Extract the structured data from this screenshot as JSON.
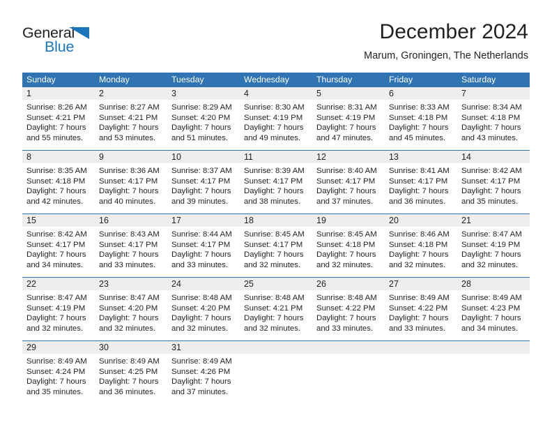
{
  "brand": {
    "name_top": "General",
    "name_bottom": "Blue",
    "accent_color": "#1b75bb",
    "triangle_icon": "triangle-icon"
  },
  "header": {
    "title": "December 2024",
    "location": "Marum, Groningen, The Netherlands",
    "header_bg_color": "#3174b4",
    "daynum_bg_color": "#eeeeee"
  },
  "weekdays": [
    "Sunday",
    "Monday",
    "Tuesday",
    "Wednesday",
    "Thursday",
    "Friday",
    "Saturday"
  ],
  "weeks": [
    {
      "days": [
        {
          "num": "1",
          "sunrise": "Sunrise: 8:26 AM",
          "sunset": "Sunset: 4:21 PM",
          "daylight1": "Daylight: 7 hours",
          "daylight2": "and 55 minutes."
        },
        {
          "num": "2",
          "sunrise": "Sunrise: 8:27 AM",
          "sunset": "Sunset: 4:21 PM",
          "daylight1": "Daylight: 7 hours",
          "daylight2": "and 53 minutes."
        },
        {
          "num": "3",
          "sunrise": "Sunrise: 8:29 AM",
          "sunset": "Sunset: 4:20 PM",
          "daylight1": "Daylight: 7 hours",
          "daylight2": "and 51 minutes."
        },
        {
          "num": "4",
          "sunrise": "Sunrise: 8:30 AM",
          "sunset": "Sunset: 4:19 PM",
          "daylight1": "Daylight: 7 hours",
          "daylight2": "and 49 minutes."
        },
        {
          "num": "5",
          "sunrise": "Sunrise: 8:31 AM",
          "sunset": "Sunset: 4:19 PM",
          "daylight1": "Daylight: 7 hours",
          "daylight2": "and 47 minutes."
        },
        {
          "num": "6",
          "sunrise": "Sunrise: 8:33 AM",
          "sunset": "Sunset: 4:18 PM",
          "daylight1": "Daylight: 7 hours",
          "daylight2": "and 45 minutes."
        },
        {
          "num": "7",
          "sunrise": "Sunrise: 8:34 AM",
          "sunset": "Sunset: 4:18 PM",
          "daylight1": "Daylight: 7 hours",
          "daylight2": "and 43 minutes."
        }
      ]
    },
    {
      "days": [
        {
          "num": "8",
          "sunrise": "Sunrise: 8:35 AM",
          "sunset": "Sunset: 4:18 PM",
          "daylight1": "Daylight: 7 hours",
          "daylight2": "and 42 minutes."
        },
        {
          "num": "9",
          "sunrise": "Sunrise: 8:36 AM",
          "sunset": "Sunset: 4:17 PM",
          "daylight1": "Daylight: 7 hours",
          "daylight2": "and 40 minutes."
        },
        {
          "num": "10",
          "sunrise": "Sunrise: 8:37 AM",
          "sunset": "Sunset: 4:17 PM",
          "daylight1": "Daylight: 7 hours",
          "daylight2": "and 39 minutes."
        },
        {
          "num": "11",
          "sunrise": "Sunrise: 8:39 AM",
          "sunset": "Sunset: 4:17 PM",
          "daylight1": "Daylight: 7 hours",
          "daylight2": "and 38 minutes."
        },
        {
          "num": "12",
          "sunrise": "Sunrise: 8:40 AM",
          "sunset": "Sunset: 4:17 PM",
          "daylight1": "Daylight: 7 hours",
          "daylight2": "and 37 minutes."
        },
        {
          "num": "13",
          "sunrise": "Sunrise: 8:41 AM",
          "sunset": "Sunset: 4:17 PM",
          "daylight1": "Daylight: 7 hours",
          "daylight2": "and 36 minutes."
        },
        {
          "num": "14",
          "sunrise": "Sunrise: 8:42 AM",
          "sunset": "Sunset: 4:17 PM",
          "daylight1": "Daylight: 7 hours",
          "daylight2": "and 35 minutes."
        }
      ]
    },
    {
      "days": [
        {
          "num": "15",
          "sunrise": "Sunrise: 8:42 AM",
          "sunset": "Sunset: 4:17 PM",
          "daylight1": "Daylight: 7 hours",
          "daylight2": "and 34 minutes."
        },
        {
          "num": "16",
          "sunrise": "Sunrise: 8:43 AM",
          "sunset": "Sunset: 4:17 PM",
          "daylight1": "Daylight: 7 hours",
          "daylight2": "and 33 minutes."
        },
        {
          "num": "17",
          "sunrise": "Sunrise: 8:44 AM",
          "sunset": "Sunset: 4:17 PM",
          "daylight1": "Daylight: 7 hours",
          "daylight2": "and 33 minutes."
        },
        {
          "num": "18",
          "sunrise": "Sunrise: 8:45 AM",
          "sunset": "Sunset: 4:17 PM",
          "daylight1": "Daylight: 7 hours",
          "daylight2": "and 32 minutes."
        },
        {
          "num": "19",
          "sunrise": "Sunrise: 8:45 AM",
          "sunset": "Sunset: 4:18 PM",
          "daylight1": "Daylight: 7 hours",
          "daylight2": "and 32 minutes."
        },
        {
          "num": "20",
          "sunrise": "Sunrise: 8:46 AM",
          "sunset": "Sunset: 4:18 PM",
          "daylight1": "Daylight: 7 hours",
          "daylight2": "and 32 minutes."
        },
        {
          "num": "21",
          "sunrise": "Sunrise: 8:47 AM",
          "sunset": "Sunset: 4:19 PM",
          "daylight1": "Daylight: 7 hours",
          "daylight2": "and 32 minutes."
        }
      ]
    },
    {
      "days": [
        {
          "num": "22",
          "sunrise": "Sunrise: 8:47 AM",
          "sunset": "Sunset: 4:19 PM",
          "daylight1": "Daylight: 7 hours",
          "daylight2": "and 32 minutes."
        },
        {
          "num": "23",
          "sunrise": "Sunrise: 8:47 AM",
          "sunset": "Sunset: 4:20 PM",
          "daylight1": "Daylight: 7 hours",
          "daylight2": "and 32 minutes."
        },
        {
          "num": "24",
          "sunrise": "Sunrise: 8:48 AM",
          "sunset": "Sunset: 4:20 PM",
          "daylight1": "Daylight: 7 hours",
          "daylight2": "and 32 minutes."
        },
        {
          "num": "25",
          "sunrise": "Sunrise: 8:48 AM",
          "sunset": "Sunset: 4:21 PM",
          "daylight1": "Daylight: 7 hours",
          "daylight2": "and 32 minutes."
        },
        {
          "num": "26",
          "sunrise": "Sunrise: 8:48 AM",
          "sunset": "Sunset: 4:22 PM",
          "daylight1": "Daylight: 7 hours",
          "daylight2": "and 33 minutes."
        },
        {
          "num": "27",
          "sunrise": "Sunrise: 8:49 AM",
          "sunset": "Sunset: 4:22 PM",
          "daylight1": "Daylight: 7 hours",
          "daylight2": "and 33 minutes."
        },
        {
          "num": "28",
          "sunrise": "Sunrise: 8:49 AM",
          "sunset": "Sunset: 4:23 PM",
          "daylight1": "Daylight: 7 hours",
          "daylight2": "and 34 minutes."
        }
      ]
    },
    {
      "days": [
        {
          "num": "29",
          "sunrise": "Sunrise: 8:49 AM",
          "sunset": "Sunset: 4:24 PM",
          "daylight1": "Daylight: 7 hours",
          "daylight2": "and 35 minutes."
        },
        {
          "num": "30",
          "sunrise": "Sunrise: 8:49 AM",
          "sunset": "Sunset: 4:25 PM",
          "daylight1": "Daylight: 7 hours",
          "daylight2": "and 36 minutes."
        },
        {
          "num": "31",
          "sunrise": "Sunrise: 8:49 AM",
          "sunset": "Sunset: 4:26 PM",
          "daylight1": "Daylight: 7 hours",
          "daylight2": "and 37 minutes."
        },
        {
          "num": "",
          "sunrise": "",
          "sunset": "",
          "daylight1": "",
          "daylight2": ""
        },
        {
          "num": "",
          "sunrise": "",
          "sunset": "",
          "daylight1": "",
          "daylight2": ""
        },
        {
          "num": "",
          "sunrise": "",
          "sunset": "",
          "daylight1": "",
          "daylight2": ""
        },
        {
          "num": "",
          "sunrise": "",
          "sunset": "",
          "daylight1": "",
          "daylight2": ""
        }
      ]
    }
  ]
}
